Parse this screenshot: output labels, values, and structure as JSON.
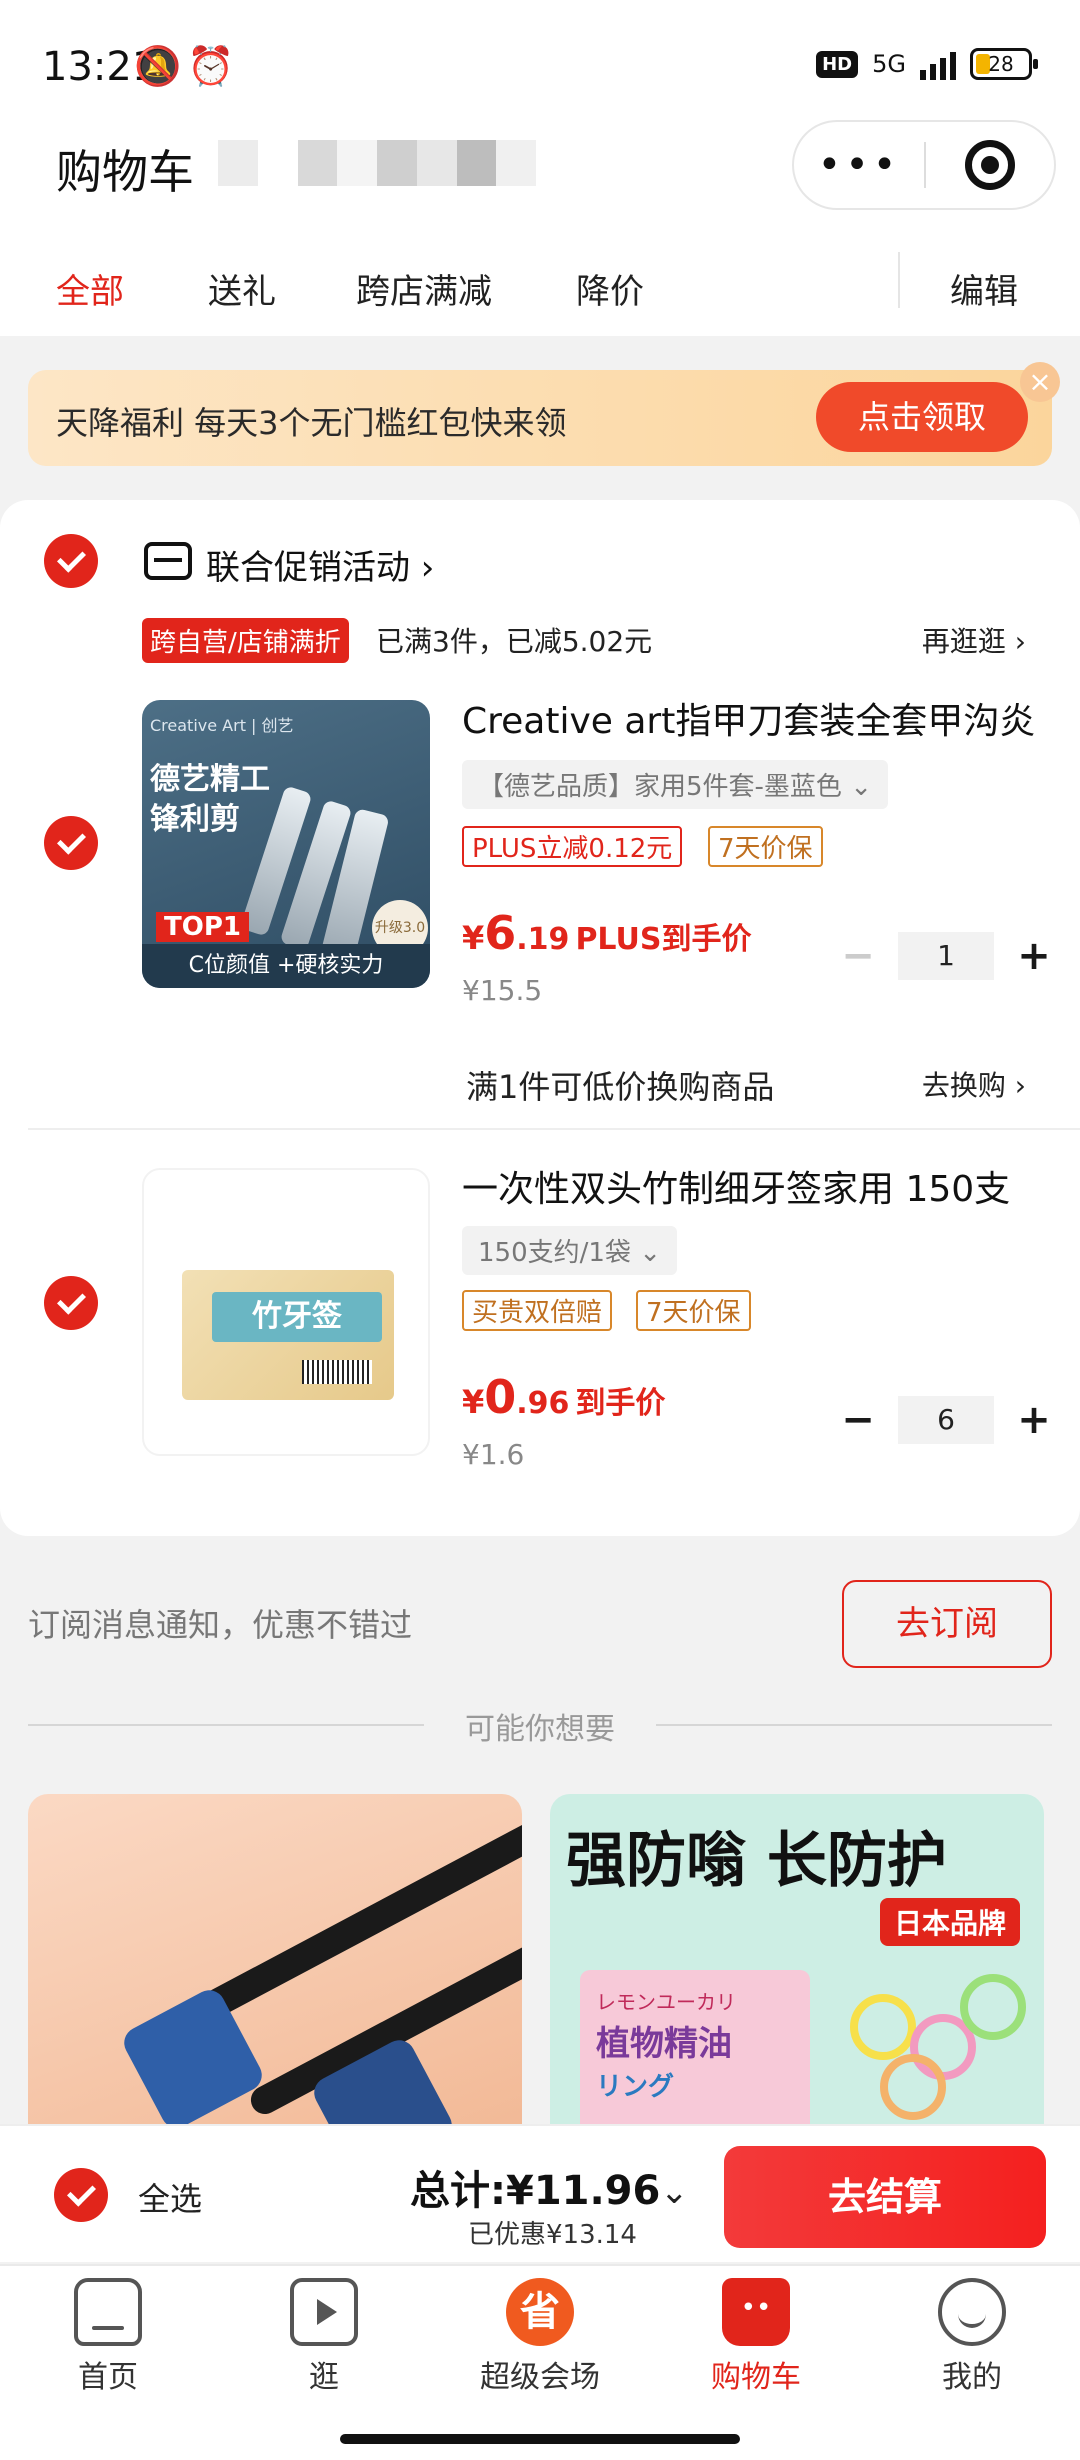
{
  "status": {
    "time": "13:21",
    "hd": "HD",
    "net": "5G",
    "battery": "28"
  },
  "header": {
    "title": "购物车"
  },
  "tabs": [
    "全部",
    "送礼",
    "跨店满减",
    "降价"
  ],
  "edit_label": "编辑",
  "banner": {
    "text": "天降福利 每天3个无门槛红包快来领",
    "button": "点击领取",
    "close": "×"
  },
  "promo": {
    "title": "联合促销活动 ›",
    "tag": "跨自营/店铺满折",
    "desc": "已满3件，已减5.02元",
    "more": "再逛逛 ›"
  },
  "items": [
    {
      "title": "Creative art指甲刀套装全套甲沟炎",
      "sku": "【德艺品质】家用5件套-墨蓝色  ⌄",
      "tags": [
        "PLUS立减0.12元",
        "7天价保"
      ],
      "price_int": "6",
      "price_dec": ".19",
      "price_note": "PLUS到手价",
      "orig": "¥15.5",
      "qty": "1",
      "img_text": {
        "l1": "Creative Art | 创艺",
        "l2a": "德艺精工",
        "l2b": "锋利剪",
        "l3": "TOP1",
        "bar": "C位颜值 +硬核实力",
        "badge": "升级3.0"
      },
      "exchange": "满1件可低价换购商品",
      "exchange_link": "去换购 ›"
    },
    {
      "title": "一次性双头竹制细牙签家用 150支",
      "sku": "150支约/1袋  ⌄",
      "tags": [
        "买贵双倍赔",
        "7天价保"
      ],
      "price_int": "0",
      "price_dec": ".96",
      "price_note": "到手价",
      "orig": "¥1.6",
      "qty": "6",
      "img_text": {
        "label": "竹牙签"
      }
    }
  ],
  "yen": "¥",
  "minus": "−",
  "plus": "+",
  "subscribe": {
    "text": "订阅消息通知，优惠不错过",
    "button": "去订阅"
  },
  "maybe": "可能你想要",
  "rec2": {
    "headline": "强防嗡 长防护",
    "badge": "日本品牌",
    "t1": "レモンユーカリ",
    "t2": "植物精油",
    "t3": "リング"
  },
  "checkout": {
    "all": "全选",
    "total": "总计:¥11.96",
    "saved": "已优惠¥13.14",
    "chevron": "⌄",
    "go": "去结算"
  },
  "tabbar": [
    {
      "label": "首页",
      "icon": "home-icon"
    },
    {
      "label": "逛",
      "icon": "play-icon"
    },
    {
      "label": "超级会场",
      "icon": "super-venue-icon",
      "glyph": "省"
    },
    {
      "label": "购物车",
      "icon": "cart-icon",
      "glyph": "••"
    },
    {
      "label": "我的",
      "icon": "me-icon"
    }
  ],
  "colors": {
    "accent": "#e1251b",
    "banner": "#fbd59c",
    "checkout": "#f4201f"
  }
}
